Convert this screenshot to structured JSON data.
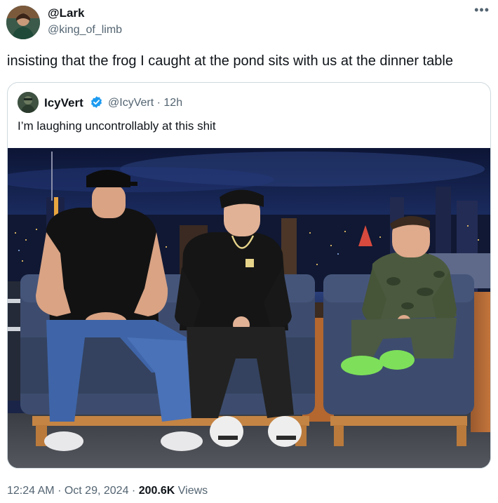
{
  "author": {
    "display_name": "@Lark",
    "handle": "@king_of_limb",
    "avatar_icon": "profile-photo"
  },
  "menu_icon": "more-dots-icon",
  "more_glyph": "•••",
  "tweet_text": "insisting that the frog I caught at the pond sits with us at the dinner table",
  "quoted": {
    "display_name": "IcyVert",
    "handle": "@IcyVert",
    "separator": "·",
    "time": "12h",
    "text": "I’m laughing uncontrollably at this shit",
    "verified_icon": "verified-badge-icon",
    "verified_color": "#1d9bf0",
    "image_icon": "talk-show-photo"
  },
  "footer": {
    "time": "12:24 AM",
    "separator": "·",
    "date": "Oct 29, 2024",
    "views_count": "200.6K",
    "views_label": "Views"
  },
  "colors": {
    "text_primary": "#0f1419",
    "text_secondary": "#536471",
    "border": "#cfd9de"
  }
}
